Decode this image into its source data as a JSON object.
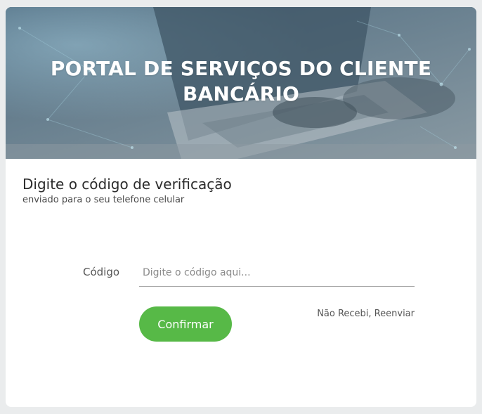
{
  "header": {
    "title_line1": "PORTAL DE SERVIÇOS DO CLIENTE",
    "title_line2": "BANCÁRIO"
  },
  "verification": {
    "heading": "Digite o código de verificação",
    "subheading": "enviado para o seu telefone celular"
  },
  "form": {
    "code_label": "Código",
    "code_placeholder": "Digite o código aqui...",
    "code_value": "",
    "confirm_label": "Confirmar",
    "resend_label": "Não Recebi, Reenviar"
  },
  "colors": {
    "accent_green": "#57b947",
    "page_background": "#eaeced",
    "hero_tint": "#5a7689"
  }
}
